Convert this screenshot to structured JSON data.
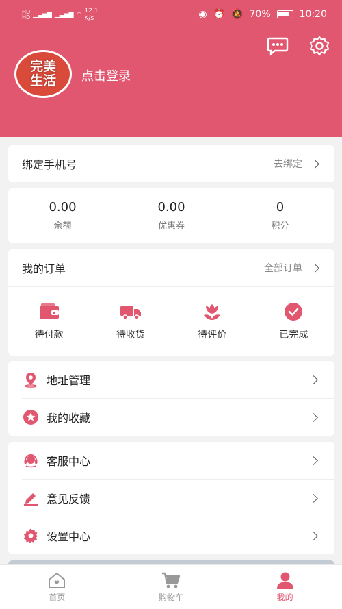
{
  "status_bar": {
    "network": "12.1\nK/s",
    "network_line1": "12.1",
    "network_line2": "K/s",
    "battery": "70%",
    "time": "10:20"
  },
  "header": {
    "logo_line1": "完美",
    "logo_line2": "生活",
    "login_text": "点击登录",
    "icons": [
      "chat-icon",
      "settings-icon"
    ]
  },
  "bind_phone": {
    "label": "绑定手机号",
    "action": "去绑定"
  },
  "stats": [
    {
      "value": "0.00",
      "label": "余额"
    },
    {
      "value": "0.00",
      "label": "优惠券"
    },
    {
      "value": "0",
      "label": "积分"
    }
  ],
  "orders": {
    "title": "我的订单",
    "all_label": "全部订单",
    "items": [
      {
        "label": "待付款",
        "icon": "wallet-icon"
      },
      {
        "label": "待收货",
        "icon": "truck-icon"
      },
      {
        "label": "待评价",
        "icon": "flower-icon"
      },
      {
        "label": "已完成",
        "icon": "check-circle-icon"
      }
    ]
  },
  "menu1": [
    {
      "label": "地址管理",
      "icon": "location-icon"
    },
    {
      "label": "我的收藏",
      "icon": "star-icon"
    }
  ],
  "menu2": [
    {
      "label": "客服中心",
      "icon": "headset-icon"
    },
    {
      "label": "意见反馈",
      "icon": "edit-icon"
    },
    {
      "label": "设置中心",
      "icon": "gear-icon"
    }
  ],
  "tabs": [
    {
      "label": "首页",
      "icon": "home-icon"
    },
    {
      "label": "购物车",
      "icon": "cart-icon"
    },
    {
      "label": "我的",
      "icon": "user-icon",
      "active": true
    }
  ],
  "colors": {
    "accent": "#e25770",
    "background": "#f2f2f2"
  }
}
